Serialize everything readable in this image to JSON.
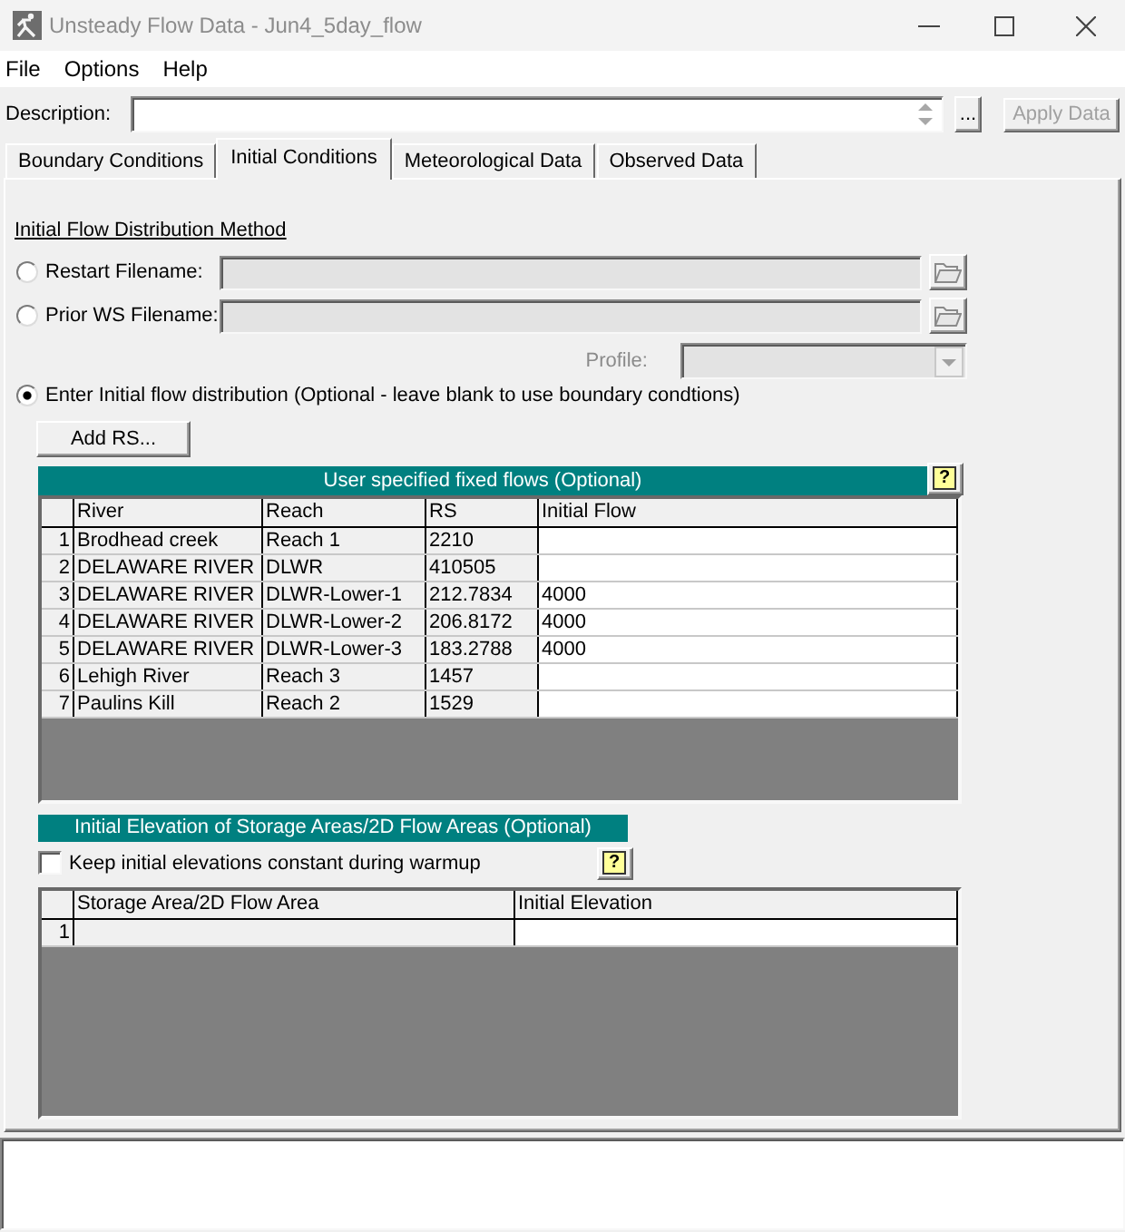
{
  "window": {
    "title": "Unsteady Flow Data - Jun4_5day_flow"
  },
  "menu": [
    "File",
    "Options",
    "Help"
  ],
  "description": {
    "label": "Description:",
    "more_button": "..."
  },
  "apply_button": {
    "label": "Apply Data",
    "disabled": true
  },
  "tabs": [
    {
      "label": "Boundary Conditions",
      "selected": false
    },
    {
      "label": "Initial Conditions",
      "selected": true
    },
    {
      "label": "Meteorological Data",
      "selected": false
    },
    {
      "label": "Observed Data",
      "selected": false
    }
  ],
  "method": {
    "heading": "Initial Flow Distribution Method",
    "options": [
      {
        "kind": "file",
        "label": "Restart Filename:",
        "selected": false,
        "disabled": true
      },
      {
        "kind": "file",
        "label": "Prior WS Filename:",
        "selected": false,
        "disabled": true,
        "profile": {
          "label": "Profile:",
          "disabled": true
        }
      },
      {
        "kind": "plain",
        "label": "Enter Initial flow distribution (Optional - leave blank to use boundary condtions)",
        "selected": true
      }
    ],
    "add_button": "Add RS..."
  },
  "flows_table": {
    "title": "User specified fixed flows (Optional)",
    "help_button": "?",
    "columns": [
      {
        "label": "River",
        "editable": false
      },
      {
        "label": "Reach",
        "editable": false
      },
      {
        "label": "RS",
        "editable": false
      },
      {
        "label": "Initial Flow",
        "editable": true
      }
    ],
    "rows": [
      {
        "number": "1",
        "cells": [
          "Brodhead creek",
          "Reach 1",
          "2210"
        ]
      },
      {
        "number": "2",
        "cells": [
          "DELAWARE RIVER",
          "DLWR",
          "410505"
        ]
      },
      {
        "number": "3",
        "cells": [
          "DELAWARE RIVER",
          "DLWR-Lower-1",
          "212.7834",
          "4000"
        ]
      },
      {
        "number": "4",
        "cells": [
          "DELAWARE RIVER",
          "DLWR-Lower-2",
          "206.8172",
          "4000"
        ]
      },
      {
        "number": "5",
        "cells": [
          "DELAWARE RIVER",
          "DLWR-Lower-3",
          "183.2788",
          "4000"
        ]
      },
      {
        "number": "6",
        "cells": [
          "Lehigh River",
          "Reach 3",
          "1457"
        ]
      },
      {
        "number": "7",
        "cells": [
          "Paulins Kill",
          "Reach 2",
          "1529"
        ]
      }
    ]
  },
  "storage_table": {
    "title": "Initial Elevation of Storage Areas/2D Flow Areas (Optional)",
    "help_button": "?",
    "checkbox": {
      "label": "Keep initial elevations constant during warmup",
      "checked": false
    },
    "columns": [
      {
        "label": "Storage Area/2D Flow Area",
        "editable": false
      },
      {
        "label": "Initial Elevation",
        "editable": true
      }
    ],
    "rows": [
      {
        "number": "1"
      }
    ]
  }
}
